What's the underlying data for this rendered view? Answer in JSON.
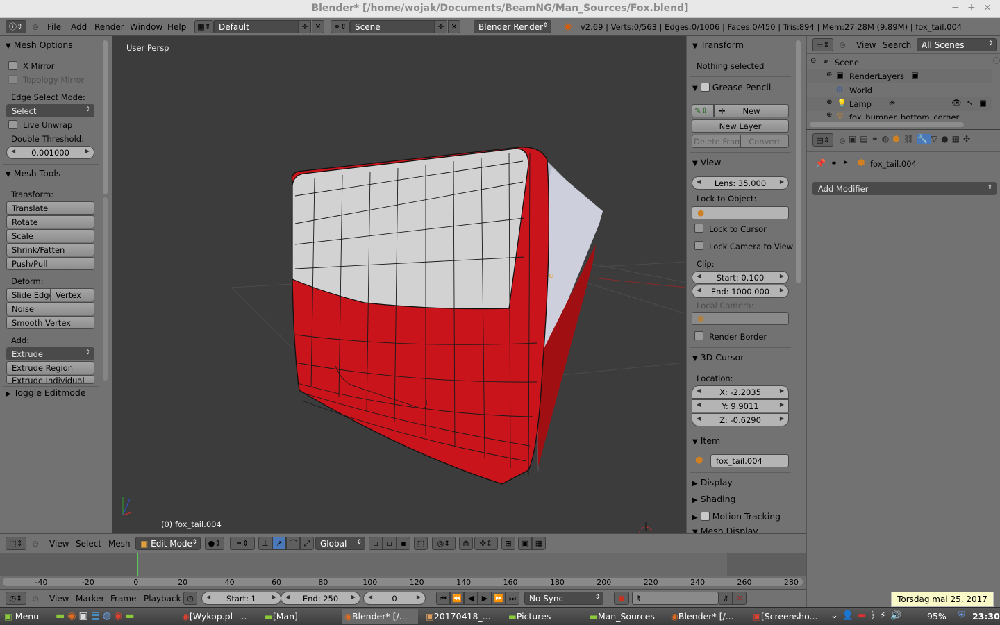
{
  "window": {
    "title": "Blender* [/home/wojak/Documents/BeamNG/Man_Sources/Fox.blend]",
    "minimize": "−",
    "maximize": "+",
    "close": "×"
  },
  "info_header": {
    "menus": [
      "File",
      "Add",
      "Render",
      "Window",
      "Help"
    ],
    "layout": "Default",
    "scene": "Scene",
    "engine": "Blender Render",
    "stats": "v2.69 | Verts:0/563 | Edges:0/1006 | Faces:0/450 | Tris:894 | Mem:27.28M (9.89M) | fox_tail.004"
  },
  "toolshelf": {
    "mesh_options": {
      "title": "Mesh Options",
      "x_mirror": "X Mirror",
      "topology_mirror": "Topology Mirror",
      "edge_select_mode_label": "Edge Select Mode:",
      "edge_select_mode_value": "Select",
      "live_unwrap": "Live Unwrap",
      "double_threshold_label": "Double Threshold:",
      "double_threshold_value": "0.001000"
    },
    "mesh_tools": {
      "title": "Mesh Tools",
      "transform_label": "Transform:",
      "translate": "Translate",
      "rotate": "Rotate",
      "scale": "Scale",
      "shrink_fatten": "Shrink/Fatten",
      "push_pull": "Push/Pull",
      "deform_label": "Deform:",
      "slide_edge": "Slide Edge",
      "vertex": "Vertex",
      "noise": "Noise",
      "smooth_vertex": "Smooth Vertex",
      "add_label": "Add:",
      "extrude": "Extrude",
      "extrude_region": "Extrude Region",
      "extrude_individual": "Extrude Individual"
    },
    "toggle_editmode": "Toggle Editmode"
  },
  "viewport": {
    "view_label": "User Persp",
    "object_label": "(0) fox_tail.004",
    "colors": {
      "body": "#c8141a",
      "window": "#d2d2d2",
      "side": "#b8bccc"
    }
  },
  "properties_region": {
    "transform_title": "Transform",
    "nothing_selected": "Nothing selected",
    "grease_pencil_title": "Grease Pencil",
    "new": "New",
    "new_layer": "New Layer",
    "delete_frame": "Delete Frame",
    "convert": "Convert",
    "view_title": "View",
    "lens": "Lens: 35.000",
    "lock_to_object": "Lock to Object:",
    "lock_to_cursor": "Lock to Cursor",
    "lock_camera_to_view": "Lock Camera to View",
    "clip_label": "Clip:",
    "clip_start": "Start: 0.100",
    "clip_end": "End: 1000.000",
    "local_camera": "Local Camera:",
    "render_border": "Render Border",
    "cursor_title": "3D Cursor",
    "location_label": "Location:",
    "cursor_x": "X: -2.2035",
    "cursor_y": "Y: 9.9011",
    "cursor_z": "Z: -0.6290",
    "item_title": "Item",
    "item_name": "fox_tail.004",
    "display_title": "Display",
    "shading_title": "Shading",
    "motion_tracking_title": "Motion Tracking",
    "mesh_display_title": "Mesh Display"
  },
  "outliner": {
    "view": "View",
    "search": "Search",
    "filter": "All Scenes",
    "rows": [
      "Scene",
      "RenderLayers",
      "World",
      "Lamp",
      "fox_bumper_bottom_corner"
    ]
  },
  "properties_editor": {
    "object_name": "fox_tail.004",
    "add_modifier": "Add Modifier"
  },
  "viewport_header": {
    "view": "View",
    "select": "Select",
    "mesh": "Mesh",
    "mode": "Edit Mode",
    "orientation": "Global"
  },
  "timeline": {
    "ticks": [
      "-40",
      "-20",
      "0",
      "20",
      "40",
      "60",
      "80",
      "100",
      "120",
      "140",
      "160",
      "180",
      "200",
      "220",
      "240",
      "260",
      "280"
    ],
    "view": "View",
    "marker": "Marker",
    "frame": "Frame",
    "playback": "Playback",
    "start": "Start: 1",
    "end": "End: 250",
    "current": "0",
    "sync": "No Sync"
  },
  "taskbar": {
    "menu": "Menu",
    "tasks": [
      "[Wykop.pl -...",
      "[Man]",
      "Blender* [/...",
      "20170418_...",
      "Pictures",
      "Man_Sources",
      "Blender* [/...",
      "[Screensho..."
    ],
    "battery": "95%",
    "clock": "23:30",
    "date_tooltip": "Torsdag mai 25, 2017"
  }
}
